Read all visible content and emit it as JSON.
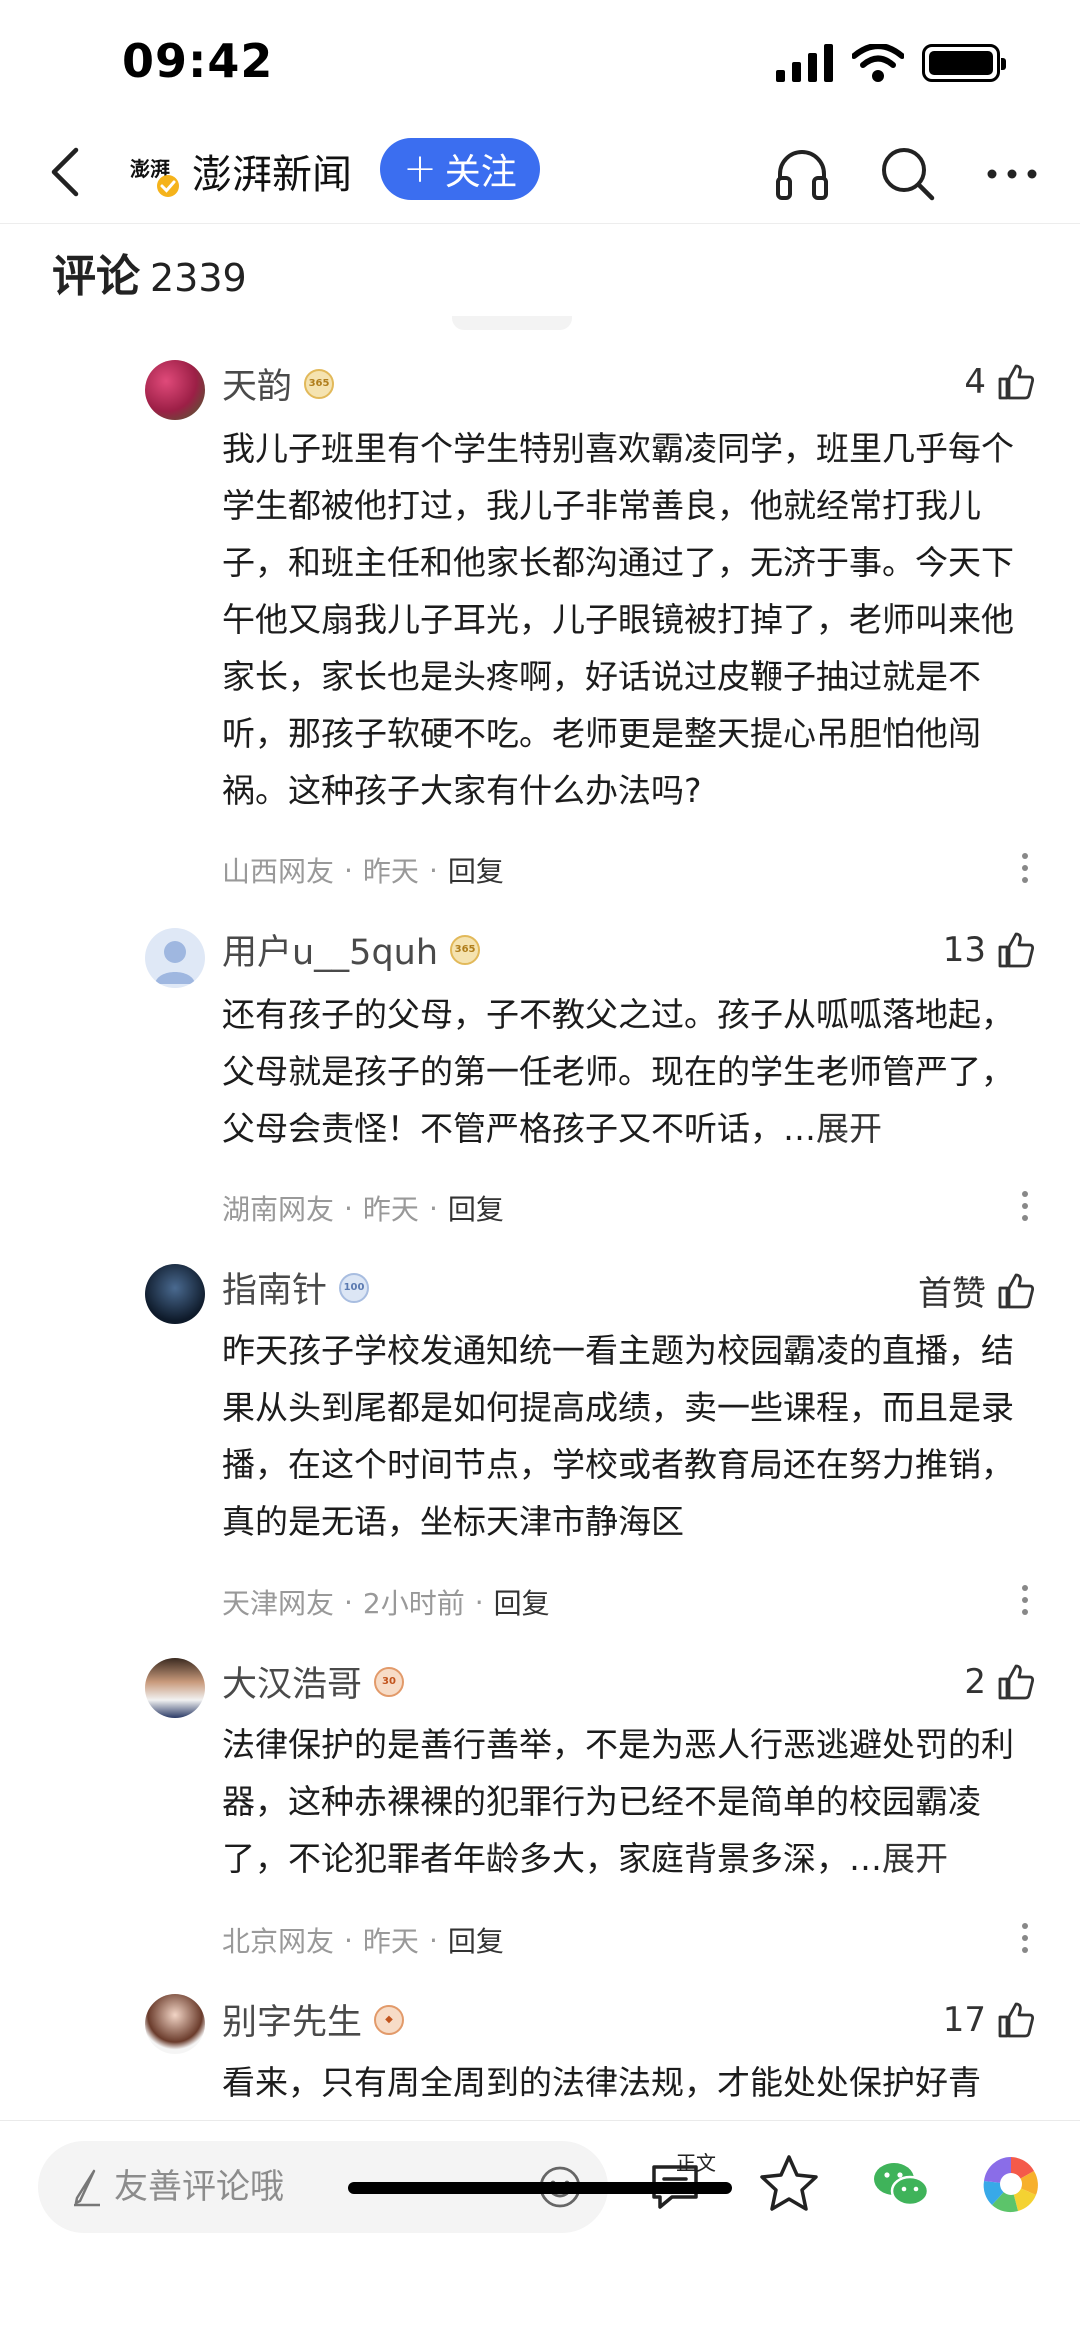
{
  "status_bar": {
    "time": "09:42"
  },
  "nav": {
    "source_name": "澎湃新闻",
    "follow_label": "关注",
    "follow_plus": "+"
  },
  "comments_header": {
    "title": "评论",
    "count": "2339"
  },
  "comments": [
    {
      "username": "天韵",
      "badge": "365",
      "likes": "4",
      "body": "我儿子班里有个学生特别喜欢霸凌同学，班里几乎每个学生都被他打过，我儿子非常善良，他就经常打我儿子，和班主任和他家长都沟通过了，无济于事。今天下午他又扇我儿子耳光，儿子眼镜被打掉了，老师叫来他家长，家长也是头疼啊，好话说过皮鞭子抽过就是不听，那孩子软硬不吃。老师更是整天提心吊胆怕他闯祸。这种孩子大家有什么办法吗?",
      "expand": "",
      "location": "山西网友",
      "time": "昨天",
      "reply": "回复"
    },
    {
      "username": "用户u__5quh",
      "badge": "365",
      "likes": "13",
      "body": "还有孩子的父母，子不教父之过。孩子从呱呱落地起，父母就是孩子的第一任老师。现在的学生老师管严了，父母会责怪！不管严格孩子又不听话，…",
      "expand": "展开",
      "location": "湖南网友",
      "time": "昨天",
      "reply": "回复"
    },
    {
      "username": "指南针",
      "badge": "100",
      "likes": "首赞",
      "body": "昨天孩子学校发通知统一看主题为校园霸凌的直播，结果从头到尾都是如何提高成绩，卖一些课程，而且是录播，在这个时间节点，学校或者教育局还在努力推销，真的是无语，坐标天津市静海区",
      "expand": "",
      "location": "天津网友",
      "time": "2小时前",
      "reply": "回复"
    },
    {
      "username": "大汉浩哥",
      "badge": "30",
      "likes": "2",
      "body": "法律保护的是善行善举，不是为恶人行恶逃避处罚的利器，这种赤裸裸的犯罪行为已经不是简单的校园霸凌了，不论犯罪者年龄多大，家庭背景多深，…",
      "expand": "展开",
      "location": "北京网友",
      "time": "昨天",
      "reply": "回复"
    },
    {
      "username": "别字先生",
      "badge": "",
      "likes": "17",
      "body": "看来，只有周全周到的法律法规，才能处处保护好青",
      "expand": "",
      "location": "",
      "time": "",
      "reply": ""
    }
  ],
  "bottom_bar": {
    "input_placeholder": "友善评论哦",
    "article_label": "正文"
  },
  "colors": {
    "accent": "#3b6ef0",
    "meta_gray": "#999999",
    "text": "#1c1c1c"
  },
  "icons": [
    "back-icon",
    "headphones-icon",
    "search-icon",
    "more-icon",
    "thumbs-up-icon",
    "pen-icon",
    "emoji-icon",
    "comment-icon",
    "star-icon",
    "wechat-icon",
    "moments-icon"
  ]
}
